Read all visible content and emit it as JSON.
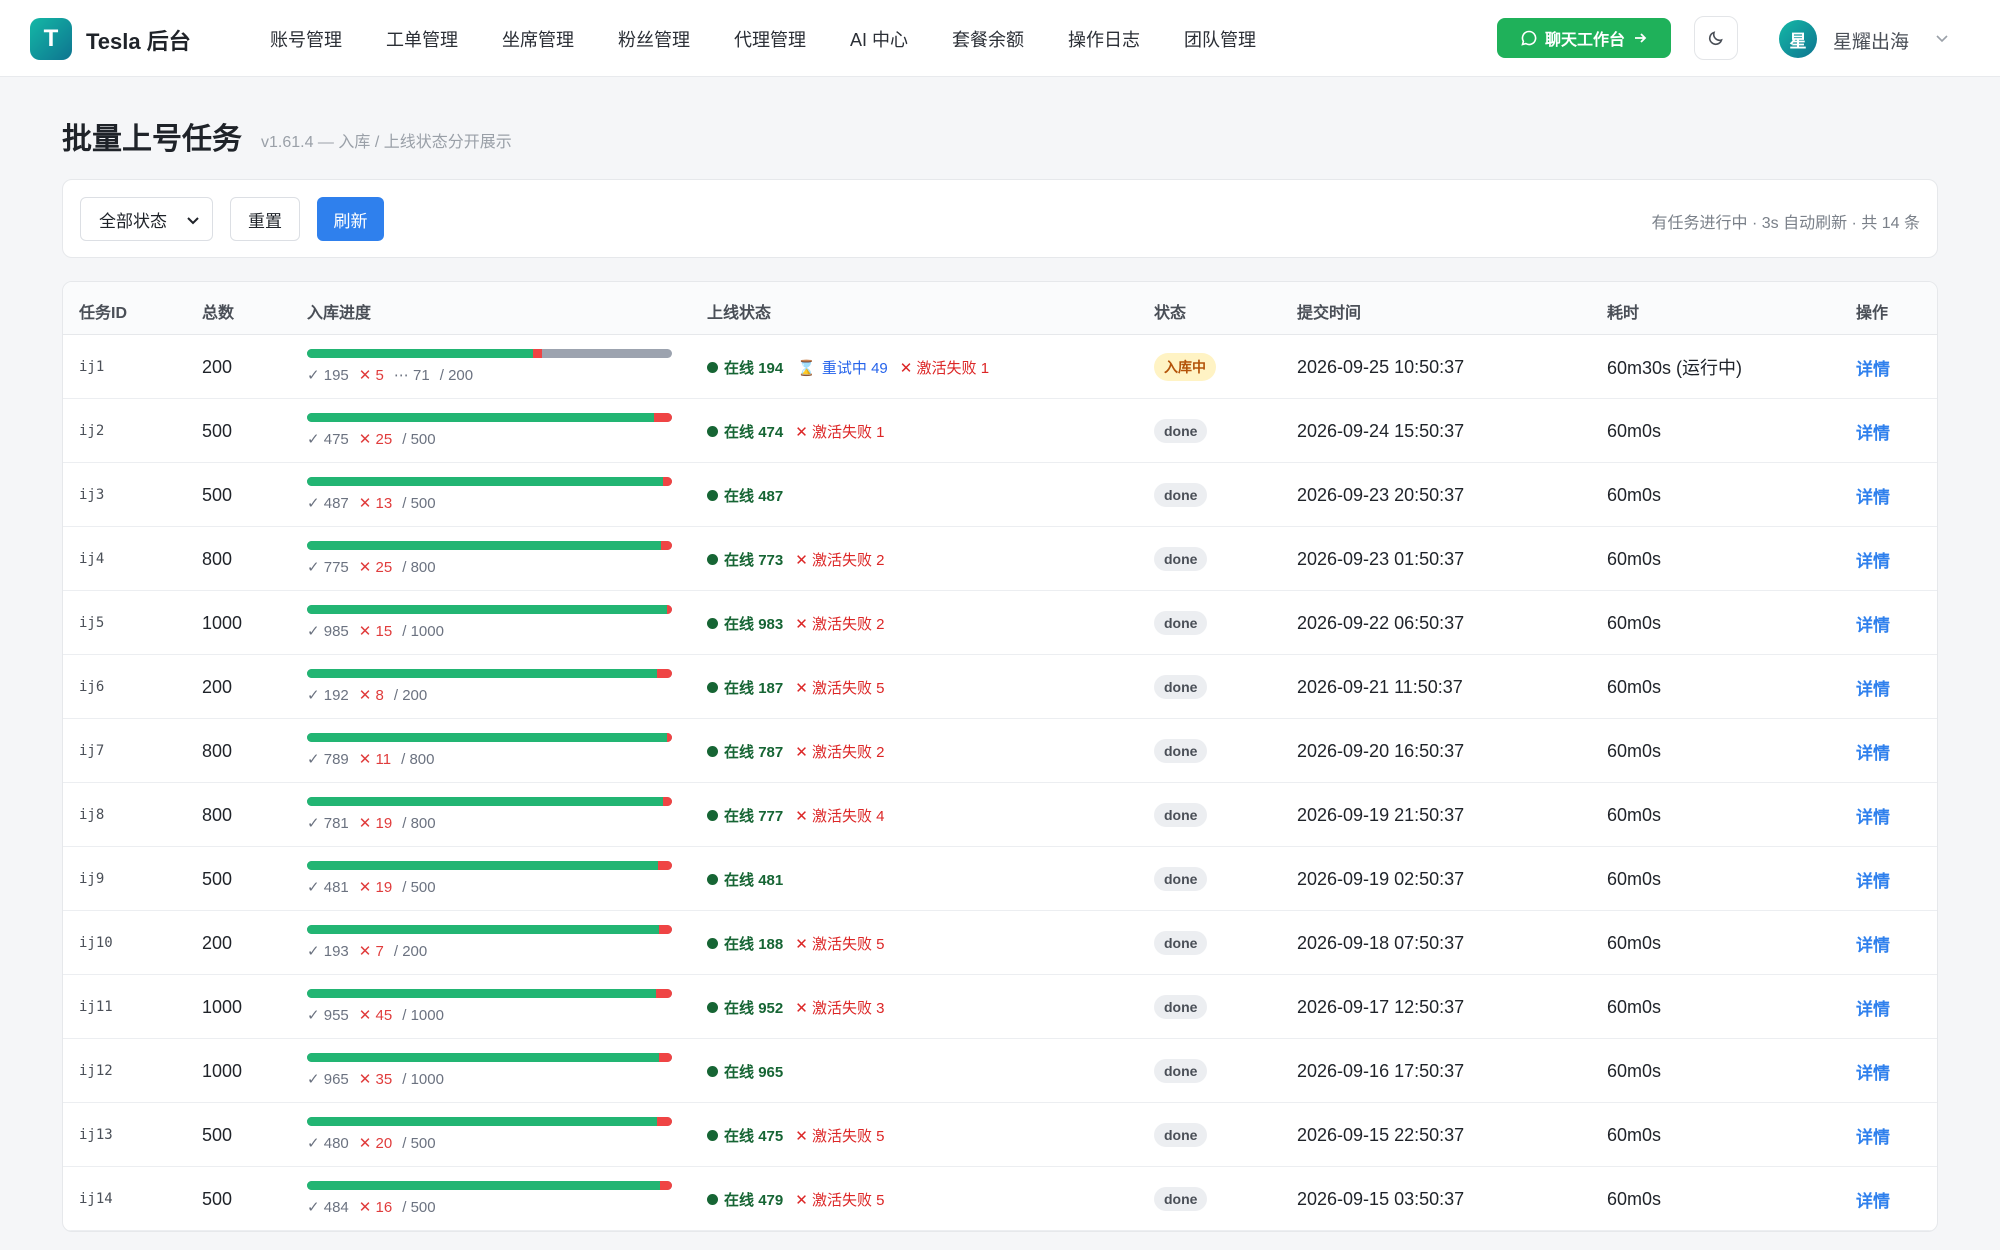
{
  "app": {
    "logo_letter": "T",
    "title": "Tesla 后台"
  },
  "nav": [
    "账号管理",
    "工单管理",
    "坐席管理",
    "粉丝管理",
    "代理管理",
    "AI 中心",
    "套餐余额",
    "操作日志",
    "团队管理"
  ],
  "header": {
    "chat_button": "聊天工作台",
    "avatar_letter": "星",
    "user_name": "星耀出海"
  },
  "page": {
    "title": "批量上号任务",
    "subtitle": "v1.61.4 — 入库 / 上线状态分开展示"
  },
  "filters": {
    "status_select": "全部状态",
    "reset_label": "重置",
    "refresh_label": "刷新",
    "info": "有任务进行中 · 3s 自动刷新 · 共 14 条"
  },
  "table": {
    "columns": [
      "任务ID",
      "总数",
      "入库进度",
      "上线状态",
      "状态",
      "提交时间",
      "耗时",
      "操作"
    ],
    "detail_label": "详情",
    "online_prefix": "在线",
    "retry_prefix": "重试中",
    "fail_prefix": "激活失败",
    "rows": [
      {
        "id": "ij1",
        "total": 200,
        "ok": 195,
        "fail": 5,
        "pending": 71,
        "online": 194,
        "retrying": 49,
        "act_fail": 1,
        "status": "入库中",
        "time": "2026-09-25 10:50:37",
        "duration": "60m30s (运行中)"
      },
      {
        "id": "ij2",
        "total": 500,
        "ok": 475,
        "fail": 25,
        "pending": null,
        "online": 474,
        "retrying": null,
        "act_fail": 1,
        "status": "done",
        "time": "2026-09-24 15:50:37",
        "duration": "60m0s"
      },
      {
        "id": "ij3",
        "total": 500,
        "ok": 487,
        "fail": 13,
        "pending": null,
        "online": 487,
        "retrying": null,
        "act_fail": null,
        "status": "done",
        "time": "2026-09-23 20:50:37",
        "duration": "60m0s"
      },
      {
        "id": "ij4",
        "total": 800,
        "ok": 775,
        "fail": 25,
        "pending": null,
        "online": 773,
        "retrying": null,
        "act_fail": 2,
        "status": "done",
        "time": "2026-09-23 01:50:37",
        "duration": "60m0s"
      },
      {
        "id": "ij5",
        "total": 1000,
        "ok": 985,
        "fail": 15,
        "pending": null,
        "online": 983,
        "retrying": null,
        "act_fail": 2,
        "status": "done",
        "time": "2026-09-22 06:50:37",
        "duration": "60m0s"
      },
      {
        "id": "ij6",
        "total": 200,
        "ok": 192,
        "fail": 8,
        "pending": null,
        "online": 187,
        "retrying": null,
        "act_fail": 5,
        "status": "done",
        "time": "2026-09-21 11:50:37",
        "duration": "60m0s"
      },
      {
        "id": "ij7",
        "total": 800,
        "ok": 789,
        "fail": 11,
        "pending": null,
        "online": 787,
        "retrying": null,
        "act_fail": 2,
        "status": "done",
        "time": "2026-09-20 16:50:37",
        "duration": "60m0s"
      },
      {
        "id": "ij8",
        "total": 800,
        "ok": 781,
        "fail": 19,
        "pending": null,
        "online": 777,
        "retrying": null,
        "act_fail": 4,
        "status": "done",
        "time": "2026-09-19 21:50:37",
        "duration": "60m0s"
      },
      {
        "id": "ij9",
        "total": 500,
        "ok": 481,
        "fail": 19,
        "pending": null,
        "online": 481,
        "retrying": null,
        "act_fail": null,
        "status": "done",
        "time": "2026-09-19 02:50:37",
        "duration": "60m0s"
      },
      {
        "id": "ij10",
        "total": 200,
        "ok": 193,
        "fail": 7,
        "pending": null,
        "online": 188,
        "retrying": null,
        "act_fail": 5,
        "status": "done",
        "time": "2026-09-18 07:50:37",
        "duration": "60m0s"
      },
      {
        "id": "ij11",
        "total": 1000,
        "ok": 955,
        "fail": 45,
        "pending": null,
        "online": 952,
        "retrying": null,
        "act_fail": 3,
        "status": "done",
        "time": "2026-09-17 12:50:37",
        "duration": "60m0s"
      },
      {
        "id": "ij12",
        "total": 1000,
        "ok": 965,
        "fail": 35,
        "pending": null,
        "online": 965,
        "retrying": null,
        "act_fail": null,
        "status": "done",
        "time": "2026-09-16 17:50:37",
        "duration": "60m0s"
      },
      {
        "id": "ij13",
        "total": 500,
        "ok": 480,
        "fail": 20,
        "pending": null,
        "online": 475,
        "retrying": null,
        "act_fail": 5,
        "status": "done",
        "time": "2026-09-15 22:50:37",
        "duration": "60m0s"
      },
      {
        "id": "ij14",
        "total": 500,
        "ok": 484,
        "fail": 16,
        "pending": null,
        "online": 479,
        "retrying": null,
        "act_fail": 5,
        "status": "done",
        "time": "2026-09-15 03:50:37",
        "duration": "60m0s"
      }
    ]
  },
  "colors": {
    "accent": "#2f80ed",
    "success": "#22b573",
    "danger": "#ef4444",
    "online": "#166534",
    "brand": "#14b8a6"
  }
}
